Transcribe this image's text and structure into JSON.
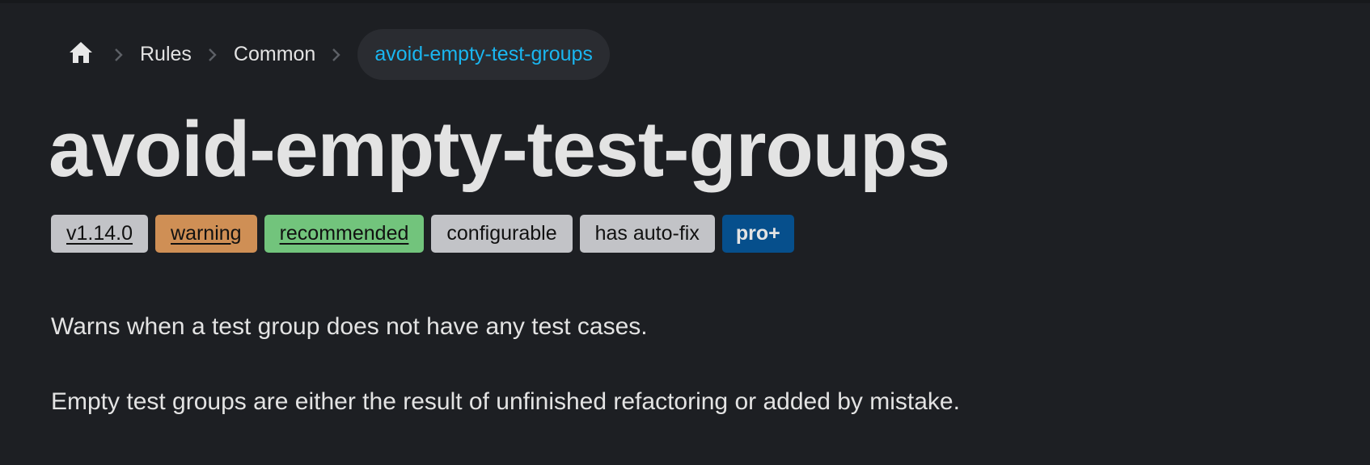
{
  "breadcrumb": {
    "home_icon": "home-icon",
    "separator_icon": "chevron-right-icon",
    "items": [
      {
        "label": "Rules"
      },
      {
        "label": "Common"
      }
    ],
    "current": "avoid-empty-test-groups"
  },
  "page": {
    "title": "avoid-empty-test-groups",
    "badges": [
      {
        "label": "v1.14.0",
        "color": "#c2c3c7"
      },
      {
        "label": "warning",
        "color": "#cf8f55"
      },
      {
        "label": "recommended",
        "color": "#72c47c"
      },
      {
        "label": "configurable",
        "color": "#c2c3c7"
      },
      {
        "label": "has auto-fix",
        "color": "#c2c3c7"
      },
      {
        "label": "pro+",
        "color": "#064f8c"
      }
    ],
    "paragraphs": [
      "Warns when a test group does not have any test cases.",
      "Empty test groups are either the result of unfinished refactoring or added by mistake."
    ]
  },
  "theme": {
    "background": "#1d1f23",
    "text": "#e3e3e3",
    "accent": "#1ab6f0"
  }
}
